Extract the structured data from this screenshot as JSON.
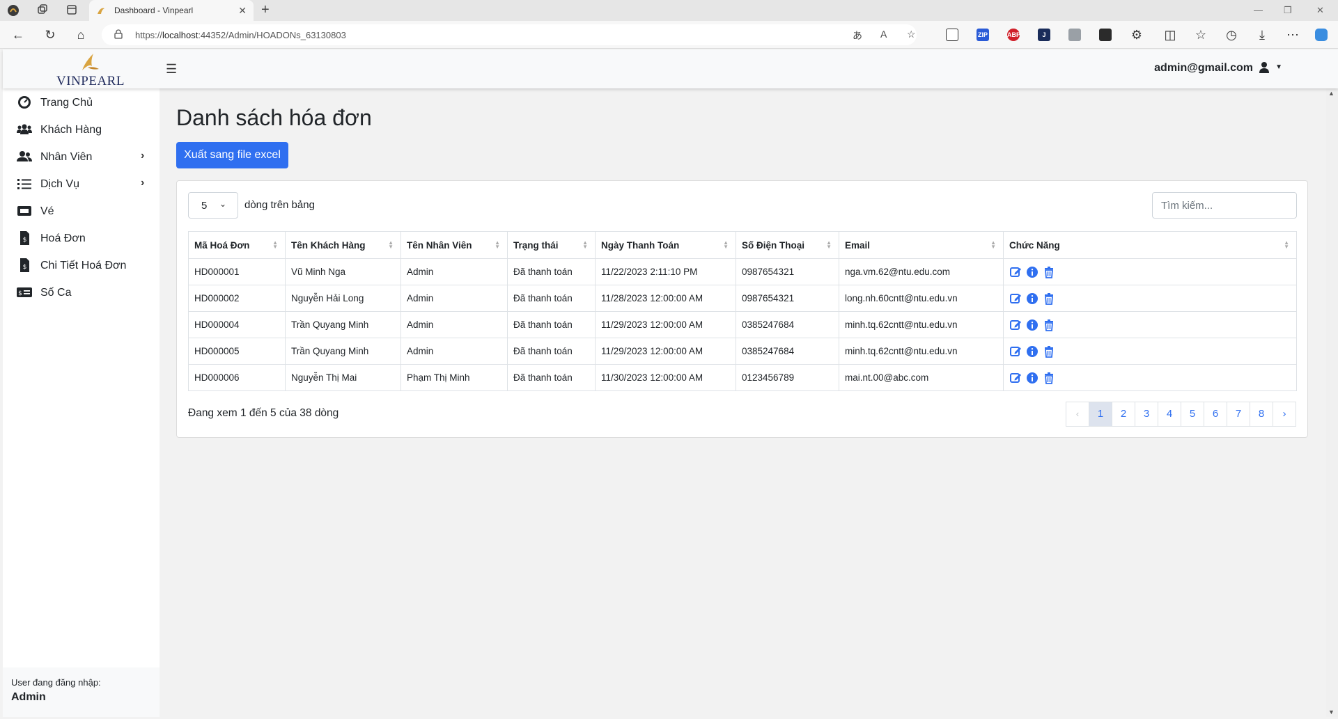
{
  "browser": {
    "tab_title": "Dashboard - Vinpearl",
    "url_prefix": "https://",
    "url_host": "localhost",
    "url_rest": ":44352/Admin/HOADONs_63130803"
  },
  "header": {
    "brand": "VINPEARL",
    "user_email": "admin@gmail.com"
  },
  "sidebar": {
    "items": [
      {
        "label": "Trang Chủ",
        "icon": "dashboard-icon"
      },
      {
        "label": "Khách Hàng",
        "icon": "users-icon"
      },
      {
        "label": "Nhân Viên",
        "icon": "user-group-icon"
      },
      {
        "label": "Dịch Vụ",
        "icon": "list-icon"
      },
      {
        "label": "Vé",
        "icon": "ticket-icon"
      },
      {
        "label": "Hoá Đơn",
        "icon": "invoice-icon"
      },
      {
        "label": "Chi Tiết Hoá Đơn",
        "icon": "invoice-detail-icon"
      },
      {
        "label": "Số Ca",
        "icon": "money-icon"
      }
    ],
    "footer_label": "User đang đăng nhập:",
    "footer_user": "Admin"
  },
  "main": {
    "title": "Danh sách hóa đơn",
    "export_button": "Xuất sang file excel",
    "page_length": "5",
    "page_length_label": "dòng trên bảng",
    "search_placeholder": "Tìm kiếm...",
    "columns": [
      "Mã Hoá Đơn",
      "Tên Khách Hàng",
      "Tên Nhân Viên",
      "Trạng thái",
      "Ngày Thanh Toán",
      "Số Điện Thoại",
      "Email",
      "Chức Năng"
    ],
    "rows": [
      [
        "HD000001",
        "Vũ Minh Nga",
        "Admin",
        "Đã thanh toán",
        "11/22/2023 2:11:10 PM",
        "0987654321",
        "nga.vm.62@ntu.edu.com"
      ],
      [
        "HD000002",
        "Nguyễn Hải Long",
        "Admin",
        "Đã thanh toán",
        "11/28/2023 12:00:00 AM",
        "0987654321",
        "long.nh.60cntt@ntu.edu.vn"
      ],
      [
        "HD000004",
        "Trần Quyang Minh",
        "Admin",
        "Đã thanh toán",
        "11/29/2023 12:00:00 AM",
        "0385247684",
        "minh.tq.62cntt@ntu.edu.vn"
      ],
      [
        "HD000005",
        "Trần Quyang Minh",
        "Admin",
        "Đã thanh toán",
        "11/29/2023 12:00:00 AM",
        "0385247684",
        "minh.tq.62cntt@ntu.edu.vn"
      ],
      [
        "HD000006",
        "Nguyễn Thị Mai",
        "Phạm Thị Minh",
        "Đã thanh toán",
        "11/30/2023 12:00:00 AM",
        "0123456789",
        "mai.nt.00@abc.com"
      ]
    ],
    "info_text": "Đang xem 1 đến 5 của 38 dòng",
    "pagination": {
      "prev": "‹",
      "pages": [
        "1",
        "2",
        "3",
        "4",
        "5",
        "6",
        "7",
        "8"
      ],
      "current": "1",
      "next": "›"
    }
  },
  "colors": {
    "primary": "#2f6ff0",
    "brand_gold": "#d9a441",
    "brand_navy": "#1f2a5c"
  }
}
